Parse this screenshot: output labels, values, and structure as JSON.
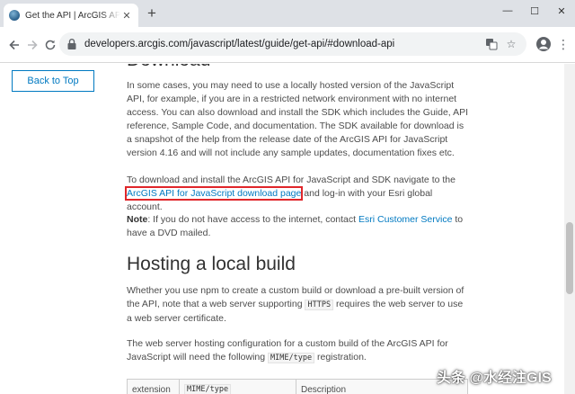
{
  "browser": {
    "tab": {
      "title": "Get the API | ArcGIS API for JavaScript",
      "close": "✕"
    },
    "new_tab": "+",
    "window": {
      "minimize": "—",
      "maximize": "☐",
      "close": "✕"
    },
    "url": "developers.arcgis.com/javascript/latest/guide/get-api/#download-api"
  },
  "sidebar": {
    "back_to_top": "Back to Top"
  },
  "download": {
    "heading": "Download",
    "p1": "In some cases, you may need to use a locally hosted version of the JavaScript API, for example, if you are in a restricted network environment with no internet access. You can also download and install the SDK which includes the Guide, API reference, Sample Code, and documentation. The SDK available for download is a snapshot of the help from the release date of the ArcGIS API for JavaScript version 4.16 and will not include any sample updates, documentation fixes etc.",
    "p2_before": "To download and install the ArcGIS API for JavaScript and SDK navigate to the ",
    "p2_link": "ArcGIS API for JavaScript download page",
    "p2_after": " and log-in with your Esri global account.",
    "note_label": "Note",
    "note_before": ": If you do not have access to the internet, contact ",
    "note_link": "Esri Customer Service",
    "note_after": " to have a DVD mailed."
  },
  "hosting": {
    "heading": "Hosting a local build",
    "p1_before": "Whether you use npm to create a custom build or download a pre-built version of the API, note that a web server supporting ",
    "p1_code": "HTTPS",
    "p1_after": " requires the web server to use a web server certificate.",
    "p2_before": "The web server hosting configuration for a custom build of the ArcGIS API for JavaScript will need the following ",
    "p2_code": "MIME/type",
    "p2_after": " registration.",
    "table_headers": [
      "extension",
      "MIME/type",
      "Description"
    ]
  },
  "watermark": "头条 @水经注GIS"
}
